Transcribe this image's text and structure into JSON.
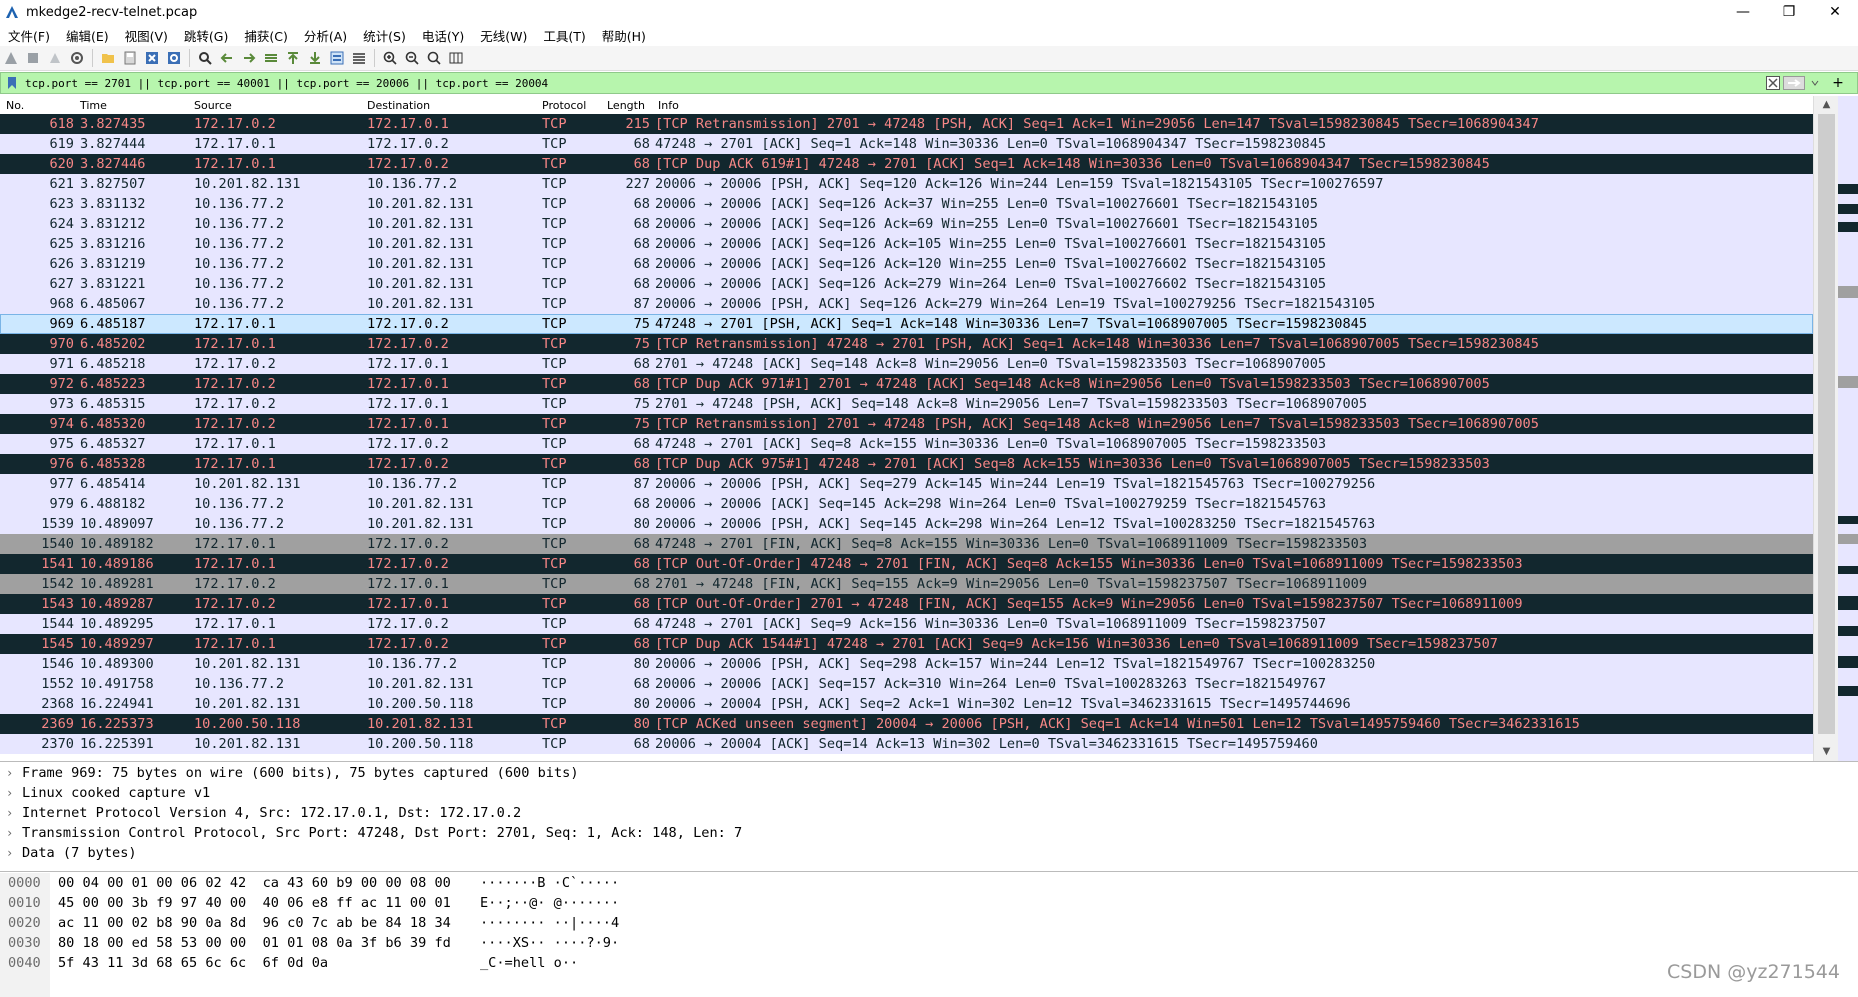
{
  "window": {
    "title": "mkedge2-recv-telnet.pcap"
  },
  "menu": [
    "文件(F)",
    "编辑(E)",
    "视图(V)",
    "跳转(G)",
    "捕获(C)",
    "分析(A)",
    "统计(S)",
    "电话(Y)",
    "无线(W)",
    "工具(T)",
    "帮助(H)"
  ],
  "filter": {
    "text": "tcp.port == 2701 || tcp.port == 40001 || tcp.port == 20006 || tcp.port == 20004"
  },
  "columns": {
    "no": "No.",
    "time": "Time",
    "source": "Source",
    "destination": "Destination",
    "protocol": "Protocol",
    "length": "Length",
    "info": "Info"
  },
  "colors": {
    "error_bg": "#12272e",
    "error_fg": "#f78787",
    "tcp_bg": "#e7e6ff",
    "fin_bg": "#a0a0a0",
    "selected_bg": "#cce8ff",
    "filter_bg": "#b7f5ad"
  },
  "packets": [
    {
      "no": "618",
      "time": "3.827435",
      "src": "172.17.0.2",
      "dst": "172.17.0.1",
      "proto": "TCP",
      "len": "215",
      "info": "[TCP Retransmission] 2701 → 47248 [PSH, ACK] Seq=1 Ack=1 Win=29056 Len=147 TSval=1598230845 TSecr=1068904347",
      "style": "err"
    },
    {
      "no": "619",
      "time": "3.827444",
      "src": "172.17.0.1",
      "dst": "172.17.0.2",
      "proto": "TCP",
      "len": "68",
      "info": "47248 → 2701 [ACK] Seq=1 Ack=148 Win=30336 Len=0 TSval=1068904347 TSecr=1598230845",
      "style": "tcp"
    },
    {
      "no": "620",
      "time": "3.827446",
      "src": "172.17.0.1",
      "dst": "172.17.0.2",
      "proto": "TCP",
      "len": "68",
      "info": "[TCP Dup ACK 619#1] 47248 → 2701 [ACK] Seq=1 Ack=148 Win=30336 Len=0 TSval=1068904347 TSecr=1598230845",
      "style": "err"
    },
    {
      "no": "621",
      "time": "3.827507",
      "src": "10.201.82.131",
      "dst": "10.136.77.2",
      "proto": "TCP",
      "len": "227",
      "info": "20006 → 20006 [PSH, ACK] Seq=120 Ack=126 Win=244 Len=159 TSval=1821543105 TSecr=100276597",
      "style": "tcp"
    },
    {
      "no": "623",
      "time": "3.831132",
      "src": "10.136.77.2",
      "dst": "10.201.82.131",
      "proto": "TCP",
      "len": "68",
      "info": "20006 → 20006 [ACK] Seq=126 Ack=37 Win=255 Len=0 TSval=100276601 TSecr=1821543105",
      "style": "tcp"
    },
    {
      "no": "624",
      "time": "3.831212",
      "src": "10.136.77.2",
      "dst": "10.201.82.131",
      "proto": "TCP",
      "len": "68",
      "info": "20006 → 20006 [ACK] Seq=126 Ack=69 Win=255 Len=0 TSval=100276601 TSecr=1821543105",
      "style": "tcp"
    },
    {
      "no": "625",
      "time": "3.831216",
      "src": "10.136.77.2",
      "dst": "10.201.82.131",
      "proto": "TCP",
      "len": "68",
      "info": "20006 → 20006 [ACK] Seq=126 Ack=105 Win=255 Len=0 TSval=100276601 TSecr=1821543105",
      "style": "tcp"
    },
    {
      "no": "626",
      "time": "3.831219",
      "src": "10.136.77.2",
      "dst": "10.201.82.131",
      "proto": "TCP",
      "len": "68",
      "info": "20006 → 20006 [ACK] Seq=126 Ack=120 Win=255 Len=0 TSval=100276602 TSecr=1821543105",
      "style": "tcp"
    },
    {
      "no": "627",
      "time": "3.831221",
      "src": "10.136.77.2",
      "dst": "10.201.82.131",
      "proto": "TCP",
      "len": "68",
      "info": "20006 → 20006 [ACK] Seq=126 Ack=279 Win=264 Len=0 TSval=100276602 TSecr=1821543105",
      "style": "tcp"
    },
    {
      "no": "968",
      "time": "6.485067",
      "src": "10.136.77.2",
      "dst": "10.201.82.131",
      "proto": "TCP",
      "len": "87",
      "info": "20006 → 20006 [PSH, ACK] Seq=126 Ack=279 Win=264 Len=19 TSval=100279256 TSecr=1821543105",
      "style": "tcp"
    },
    {
      "no": "969",
      "time": "6.485187",
      "src": "172.17.0.1",
      "dst": "172.17.0.2",
      "proto": "TCP",
      "len": "75",
      "info": "47248 → 2701 [PSH, ACK] Seq=1 Ack=148 Win=30336 Len=7 TSval=1068907005 TSecr=1598230845",
      "style": "sel"
    },
    {
      "no": "970",
      "time": "6.485202",
      "src": "172.17.0.1",
      "dst": "172.17.0.2",
      "proto": "TCP",
      "len": "75",
      "info": "[TCP Retransmission] 47248 → 2701 [PSH, ACK] Seq=1 Ack=148 Win=30336 Len=7 TSval=1068907005 TSecr=1598230845",
      "style": "err"
    },
    {
      "no": "971",
      "time": "6.485218",
      "src": "172.17.0.2",
      "dst": "172.17.0.1",
      "proto": "TCP",
      "len": "68",
      "info": "2701 → 47248 [ACK] Seq=148 Ack=8 Win=29056 Len=0 TSval=1598233503 TSecr=1068907005",
      "style": "tcp"
    },
    {
      "no": "972",
      "time": "6.485223",
      "src": "172.17.0.2",
      "dst": "172.17.0.1",
      "proto": "TCP",
      "len": "68",
      "info": "[TCP Dup ACK 971#1] 2701 → 47248 [ACK] Seq=148 Ack=8 Win=29056 Len=0 TSval=1598233503 TSecr=1068907005",
      "style": "err"
    },
    {
      "no": "973",
      "time": "6.485315",
      "src": "172.17.0.2",
      "dst": "172.17.0.1",
      "proto": "TCP",
      "len": "75",
      "info": "2701 → 47248 [PSH, ACK] Seq=148 Ack=8 Win=29056 Len=7 TSval=1598233503 TSecr=1068907005",
      "style": "tcp"
    },
    {
      "no": "974",
      "time": "6.485320",
      "src": "172.17.0.2",
      "dst": "172.17.0.1",
      "proto": "TCP",
      "len": "75",
      "info": "[TCP Retransmission] 2701 → 47248 [PSH, ACK] Seq=148 Ack=8 Win=29056 Len=7 TSval=1598233503 TSecr=1068907005",
      "style": "err"
    },
    {
      "no": "975",
      "time": "6.485327",
      "src": "172.17.0.1",
      "dst": "172.17.0.2",
      "proto": "TCP",
      "len": "68",
      "info": "47248 → 2701 [ACK] Seq=8 Ack=155 Win=30336 Len=0 TSval=1068907005 TSecr=1598233503",
      "style": "tcp"
    },
    {
      "no": "976",
      "time": "6.485328",
      "src": "172.17.0.1",
      "dst": "172.17.0.2",
      "proto": "TCP",
      "len": "68",
      "info": "[TCP Dup ACK 975#1] 47248 → 2701 [ACK] Seq=8 Ack=155 Win=30336 Len=0 TSval=1068907005 TSecr=1598233503",
      "style": "err"
    },
    {
      "no": "977",
      "time": "6.485414",
      "src": "10.201.82.131",
      "dst": "10.136.77.2",
      "proto": "TCP",
      "len": "87",
      "info": "20006 → 20006 [PSH, ACK] Seq=279 Ack=145 Win=244 Len=19 TSval=1821545763 TSecr=100279256",
      "style": "tcp"
    },
    {
      "no": "979",
      "time": "6.488182",
      "src": "10.136.77.2",
      "dst": "10.201.82.131",
      "proto": "TCP",
      "len": "68",
      "info": "20006 → 20006 [ACK] Seq=145 Ack=298 Win=264 Len=0 TSval=100279259 TSecr=1821545763",
      "style": "tcp"
    },
    {
      "no": "1539",
      "time": "10.489097",
      "src": "10.136.77.2",
      "dst": "10.201.82.131",
      "proto": "TCP",
      "len": "80",
      "info": "20006 → 20006 [PSH, ACK] Seq=145 Ack=298 Win=264 Len=12 TSval=100283250 TSecr=1821545763",
      "style": "tcp"
    },
    {
      "no": "1540",
      "time": "10.489182",
      "src": "172.17.0.1",
      "dst": "172.17.0.2",
      "proto": "TCP",
      "len": "68",
      "info": "47248 → 2701 [FIN, ACK] Seq=8 Ack=155 Win=30336 Len=0 TSval=1068911009 TSecr=1598233503",
      "style": "fin"
    },
    {
      "no": "1541",
      "time": "10.489186",
      "src": "172.17.0.1",
      "dst": "172.17.0.2",
      "proto": "TCP",
      "len": "68",
      "info": "[TCP Out-Of-Order] 47248 → 2701 [FIN, ACK] Seq=8 Ack=155 Win=30336 Len=0 TSval=1068911009 TSecr=1598233503",
      "style": "err"
    },
    {
      "no": "1542",
      "time": "10.489281",
      "src": "172.17.0.2",
      "dst": "172.17.0.1",
      "proto": "TCP",
      "len": "68",
      "info": "2701 → 47248 [FIN, ACK] Seq=155 Ack=9 Win=29056 Len=0 TSval=1598237507 TSecr=1068911009",
      "style": "fin"
    },
    {
      "no": "1543",
      "time": "10.489287",
      "src": "172.17.0.2",
      "dst": "172.17.0.1",
      "proto": "TCP",
      "len": "68",
      "info": "[TCP Out-Of-Order] 2701 → 47248 [FIN, ACK] Seq=155 Ack=9 Win=29056 Len=0 TSval=1598237507 TSecr=1068911009",
      "style": "err"
    },
    {
      "no": "1544",
      "time": "10.489295",
      "src": "172.17.0.1",
      "dst": "172.17.0.2",
      "proto": "TCP",
      "len": "68",
      "info": "47248 → 2701 [ACK] Seq=9 Ack=156 Win=30336 Len=0 TSval=1068911009 TSecr=1598237507",
      "style": "tcp"
    },
    {
      "no": "1545",
      "time": "10.489297",
      "src": "172.17.0.1",
      "dst": "172.17.0.2",
      "proto": "TCP",
      "len": "68",
      "info": "[TCP Dup ACK 1544#1] 47248 → 2701 [ACK] Seq=9 Ack=156 Win=30336 Len=0 TSval=1068911009 TSecr=1598237507",
      "style": "err"
    },
    {
      "no": "1546",
      "time": "10.489300",
      "src": "10.201.82.131",
      "dst": "10.136.77.2",
      "proto": "TCP",
      "len": "80",
      "info": "20006 → 20006 [PSH, ACK] Seq=298 Ack=157 Win=244 Len=12 TSval=1821549767 TSecr=100283250",
      "style": "tcp"
    },
    {
      "no": "1552",
      "time": "10.491758",
      "src": "10.136.77.2",
      "dst": "10.201.82.131",
      "proto": "TCP",
      "len": "68",
      "info": "20006 → 20006 [ACK] Seq=157 Ack=310 Win=264 Len=0 TSval=100283263 TSecr=1821549767",
      "style": "tcp"
    },
    {
      "no": "2368",
      "time": "16.224941",
      "src": "10.201.82.131",
      "dst": "10.200.50.118",
      "proto": "TCP",
      "len": "80",
      "info": "20006 → 20004 [PSH, ACK] Seq=2 Ack=1 Win=302 Len=12 TSval=3462331615 TSecr=1495744696",
      "style": "tcp"
    },
    {
      "no": "2369",
      "time": "16.225373",
      "src": "10.200.50.118",
      "dst": "10.201.82.131",
      "proto": "TCP",
      "len": "80",
      "info": "[TCP ACKed unseen segment] 20004 → 20006 [PSH, ACK] Seq=1 Ack=14 Win=501 Len=12 TSval=1495759460 TSecr=3462331615",
      "style": "err"
    },
    {
      "no": "2370",
      "time": "16.225391",
      "src": "10.201.82.131",
      "dst": "10.200.50.118",
      "proto": "TCP",
      "len": "68",
      "info": "20006 → 20004 [ACK] Seq=14 Ack=13 Win=302 Len=0 TSval=3462331615 TSecr=1495759460",
      "style": "tcp"
    }
  ],
  "details": [
    "Frame 969: 75 bytes on wire (600 bits), 75 bytes captured (600 bits)",
    "Linux cooked capture v1",
    "Internet Protocol Version 4, Src: 172.17.0.1, Dst: 172.17.0.2",
    "Transmission Control Protocol, Src Port: 47248, Dst Port: 2701, Seq: 1, Ack: 148, Len: 7",
    "Data (7 bytes)"
  ],
  "bytes": [
    {
      "off": "0000",
      "hex": "00 04 00 01 00 06 02 42  ca 43 60 b9 00 00 08 00",
      "asc": "·······B ·C`·····"
    },
    {
      "off": "0010",
      "hex": "45 00 00 3b f9 97 40 00  40 06 e8 ff ac 11 00 01",
      "asc": "E··;··@· @·······"
    },
    {
      "off": "0020",
      "hex": "ac 11 00 02 b8 90 0a 8d  96 c0 7c ab be 84 18 34",
      "asc": "········ ··|····4"
    },
    {
      "off": "0030",
      "hex": "80 18 00 ed 58 53 00 00  01 01 08 0a 3f b6 39 fd",
      "asc": "····XS·· ····?·9·"
    },
    {
      "off": "0040",
      "hex": "5f 43 11 3d 68 65 6c 6c  6f 0d 0a",
      "asc": "_C·=hell o··"
    }
  ],
  "watermark": "CSDN @yz271544"
}
